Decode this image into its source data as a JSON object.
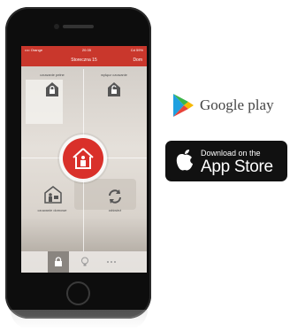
{
  "status_bar": {
    "carrier": "•••• Orange",
    "time": "20:35",
    "battery": "Cd 59%"
  },
  "nav": {
    "title": "Storeczna 15",
    "done": "Dom"
  },
  "tiles": {
    "top_left": "czuwanie pełne",
    "top_right": "wyłącz czuwanie",
    "bottom_left": "czuwanie domowe",
    "bottom_right": "odśwież"
  },
  "tabs": [
    "lock",
    "bulb",
    "more"
  ],
  "stores": {
    "google_play": "Google play",
    "app_store_small": "Download on the",
    "app_store_big": "App Store"
  },
  "colors": {
    "accent": "#c9372c",
    "center_button": "#d9302a"
  }
}
